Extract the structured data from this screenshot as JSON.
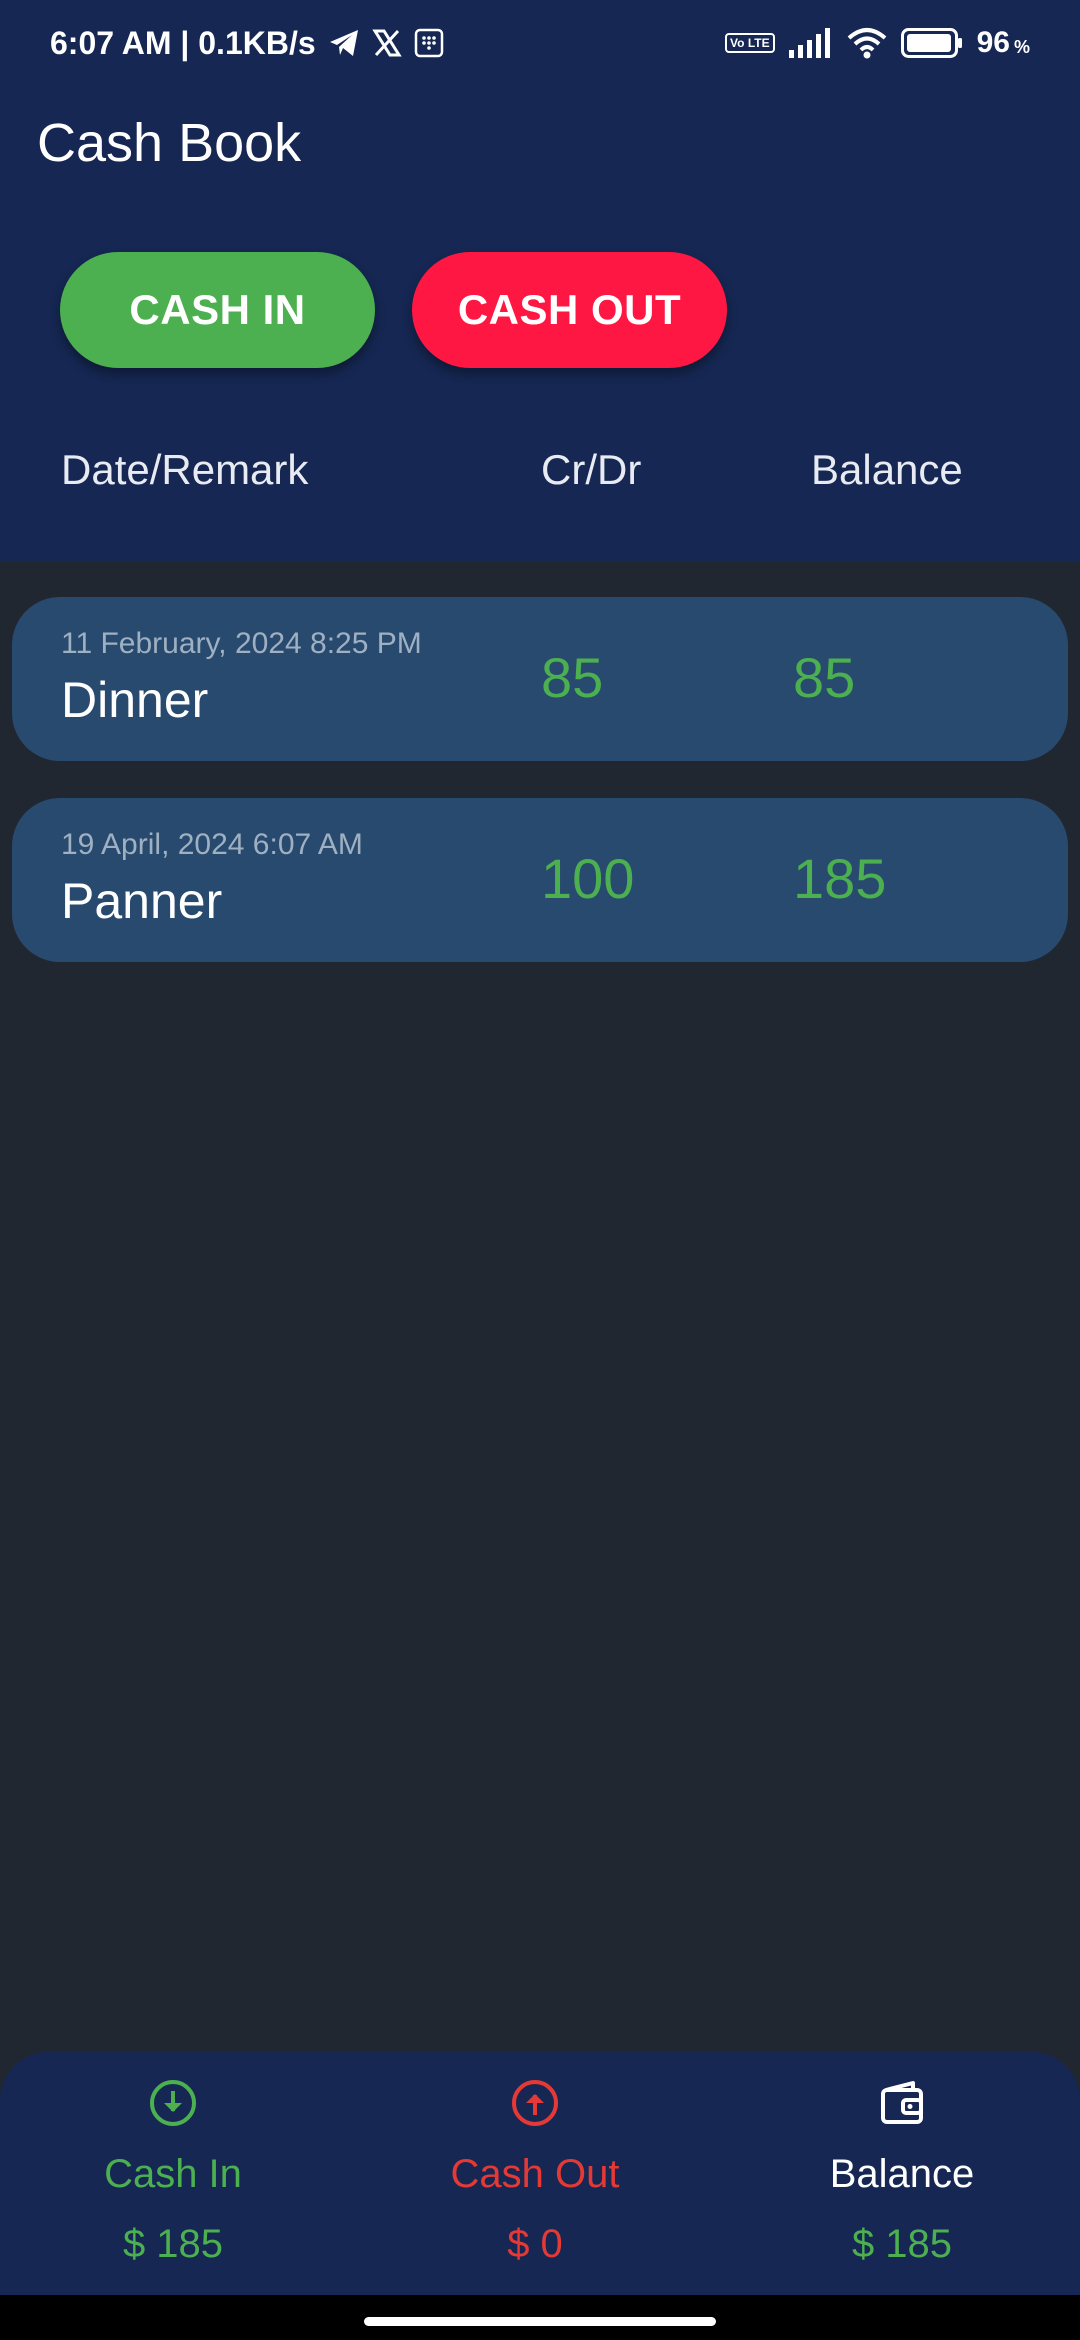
{
  "status_bar": {
    "time_speed": "6:07 AM | 0.1KB/s",
    "volte": "Vo LTE",
    "battery": "96",
    "battery_unit": "%"
  },
  "app": {
    "title": "Cash Book"
  },
  "actions": {
    "cash_in": "CASH IN",
    "cash_out": "CASH OUT"
  },
  "columns": {
    "date_remark": "Date/Remark",
    "crdr": "Cr/Dr",
    "balance": "Balance"
  },
  "entries": [
    {
      "date": "11 February, 2024 8:25 PM",
      "remark": "Dinner",
      "amount": "85",
      "balance": "85"
    },
    {
      "date": "19 April, 2024 6:07 AM",
      "remark": "Panner",
      "amount": "100",
      "balance": "185"
    }
  ],
  "summary": {
    "cash_in_label": "Cash In",
    "cash_in_value": "$ 185",
    "cash_out_label": "Cash Out",
    "cash_out_value": "$ 0",
    "balance_label": "Balance",
    "balance_value": "$ 185"
  },
  "colors": {
    "header_bg": "#152752",
    "body_bg": "#212731",
    "row_bg": "#284a6e",
    "green": "#4caf50",
    "red": "#ff1744"
  },
  "icons": [
    "telegram-icon",
    "x-icon",
    "notification-box-icon",
    "signal-icon",
    "wifi-icon",
    "battery-icon",
    "cash-in-arrow-icon",
    "cash-out-arrow-icon",
    "wallet-icon"
  ]
}
